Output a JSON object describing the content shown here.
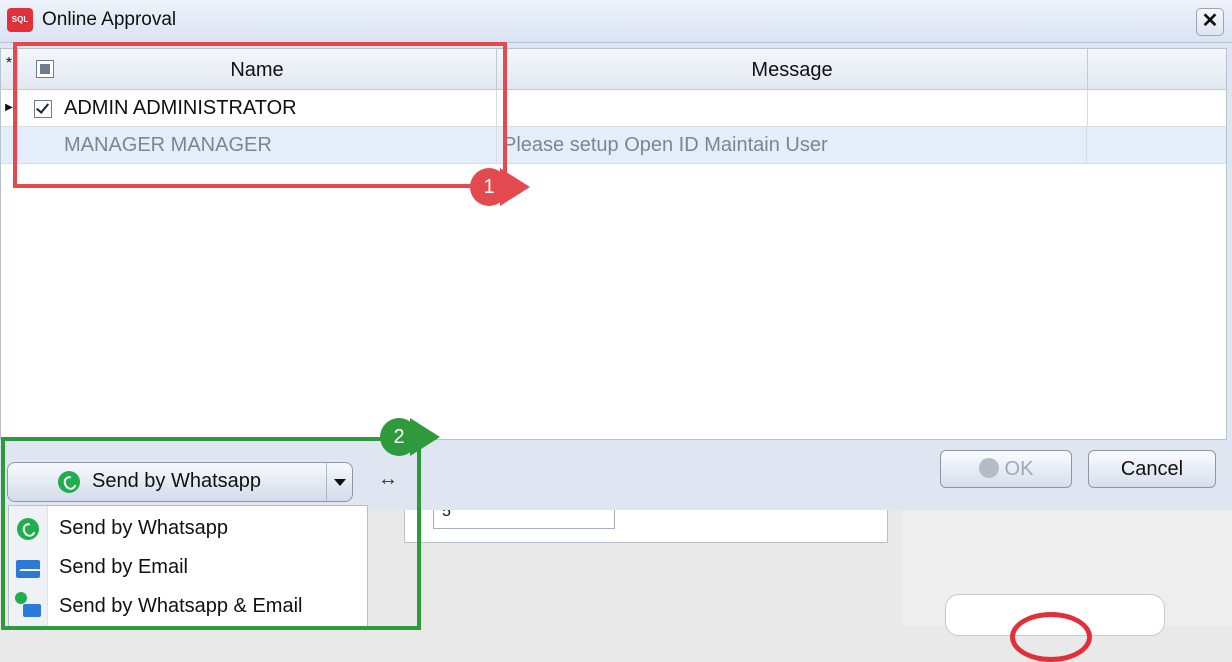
{
  "window": {
    "title": "Online Approval",
    "close_glyph": "✕"
  },
  "grid": {
    "columns": [
      "Name",
      "Message"
    ],
    "rows": [
      {
        "checked": true,
        "name": "ADMIN ADMINISTRATOR",
        "message": ""
      },
      {
        "checked": false,
        "name": "MANAGER MANAGER",
        "message": "Please setup Open ID Maintain User"
      }
    ],
    "star_glyph": "*",
    "row_pointer_glyph": "▶"
  },
  "callouts": {
    "badge1": "1",
    "badge2": "2"
  },
  "send_button": {
    "label": "Send by Whatsapp",
    "icon": "whatsapp-icon"
  },
  "splitter_glyph": "↔",
  "ok_button": {
    "label": "OK",
    "icon": "check-circle-icon"
  },
  "cancel_button": {
    "label": "Cancel"
  },
  "background_field": {
    "value": "5"
  },
  "send_menu": {
    "items": [
      {
        "label": "Send by Whatsapp",
        "icon": "whatsapp-icon"
      },
      {
        "label": "Send by Email",
        "icon": "email-icon"
      },
      {
        "label": "Send by Whatsapp & Email",
        "icon": "whatsapp-email-icon"
      }
    ]
  },
  "colors": {
    "callout_red": "#e24a4f",
    "callout_green": "#2e9a3c",
    "selected_row": "#e4eefa"
  }
}
